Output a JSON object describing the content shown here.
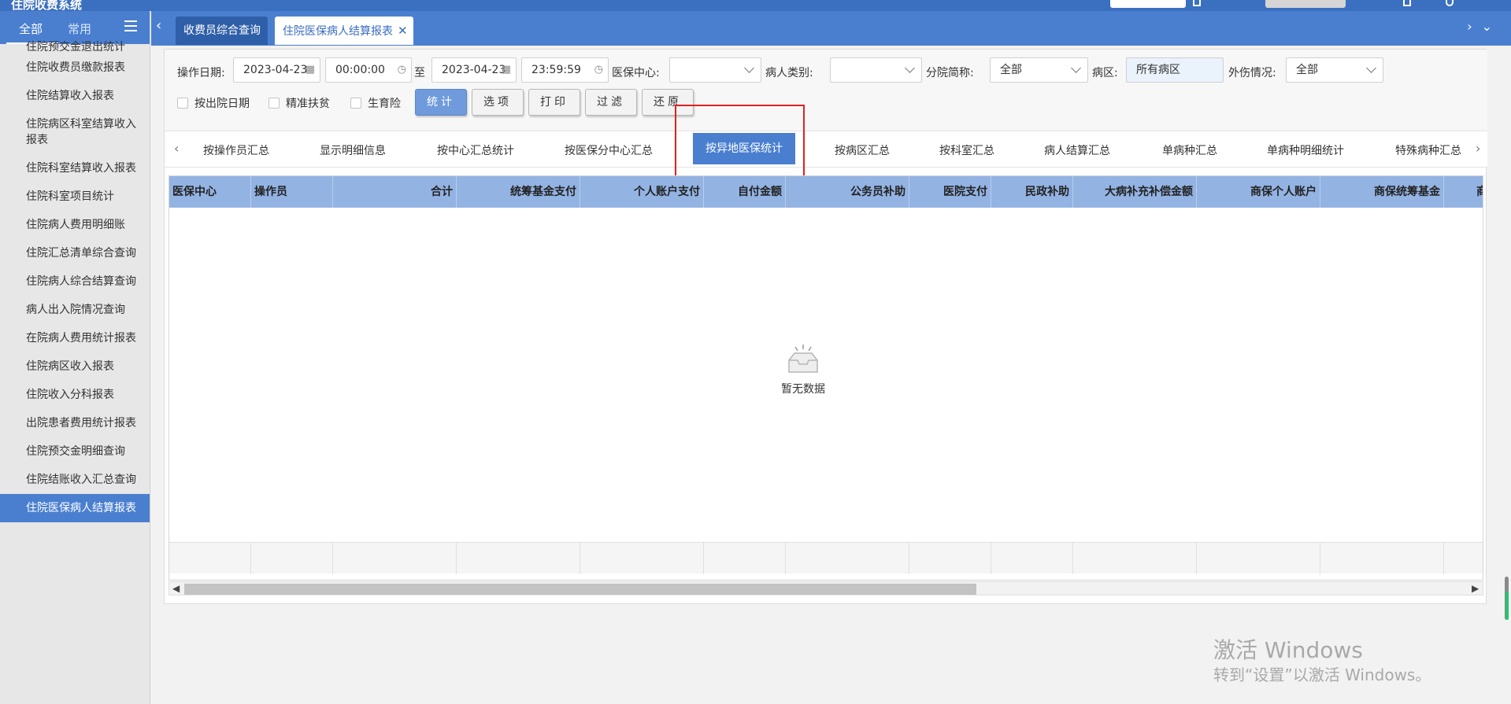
{
  "app": {
    "title": "住院收费系统"
  },
  "sidebar": {
    "tabs": {
      "all": "全部",
      "common": "常用"
    },
    "items": [
      "住院预交金退出统计",
      "住院收费员缴款报表",
      "住院结算收入报表",
      "住院病区科室结算收入报表",
      "住院科室结算收入报表",
      "住院科室项目统计",
      "住院病人费用明细账",
      "住院汇总清单综合查询",
      "住院病人综合结算查询",
      "病人出入院情况查询",
      "在院病人费用统计报表",
      "住院病区收入报表",
      "住院收入分科报表",
      "出院患者费用统计报表",
      "住院预交金明细查询",
      "住院结账收入汇总查询",
      "住院医保病人结算报表"
    ]
  },
  "tabbar": {
    "tabs": [
      {
        "label": "收费员综合查询"
      },
      {
        "label": "住院医保病人结算报表"
      }
    ]
  },
  "filters": {
    "op_date_label": "操作日期:",
    "date_from": "2023-04-23",
    "time_from": "00:00:00",
    "to_label": "至",
    "date_to": "2023-04-23",
    "time_to": "23:59:59",
    "center_label": "医保中心:",
    "center_value": "",
    "patient_type_label": "病人类别:",
    "patient_type_value": "",
    "branch_label": "分院简称:",
    "branch_value": "全部",
    "ward_label": "病区:",
    "ward_value": "所有病区",
    "injury_label": "外伤情况:",
    "injury_value": "全部",
    "checkboxes": [
      "按出院日期",
      "精准扶贫",
      "生育险"
    ],
    "buttons": {
      "stat": "统计",
      "options": "选项",
      "print": "打印",
      "filter": "过滤",
      "restore": "还原"
    }
  },
  "subtabs": [
    "按操作员汇总",
    "显示明细信息",
    "按中心汇总统计",
    "按医保分中心汇总",
    "按异地医保统计",
    "按病区汇总",
    "按科室汇总",
    "病人结算汇总",
    "单病种汇总",
    "单病种明细统计",
    "特殊病种汇总"
  ],
  "active_subtab": "按异地医保统计",
  "table": {
    "columns": [
      "医保中心",
      "操作员",
      "合计",
      "统筹基金支付",
      "个人账户支付",
      "自付金额",
      "公务员补助",
      "医院支付",
      "民政补助",
      "大病补充补偿金额",
      "商保个人账户",
      "商保统筹基金",
      "商"
    ],
    "empty_text": "暂无数据"
  },
  "watermark": {
    "line1": "激活 Windows",
    "line2": "转到“设置”以激活 Windows。"
  },
  "colors": {
    "primary": "#4a7fd0",
    "header": "#93b3e3",
    "highlight": "#e02020"
  }
}
